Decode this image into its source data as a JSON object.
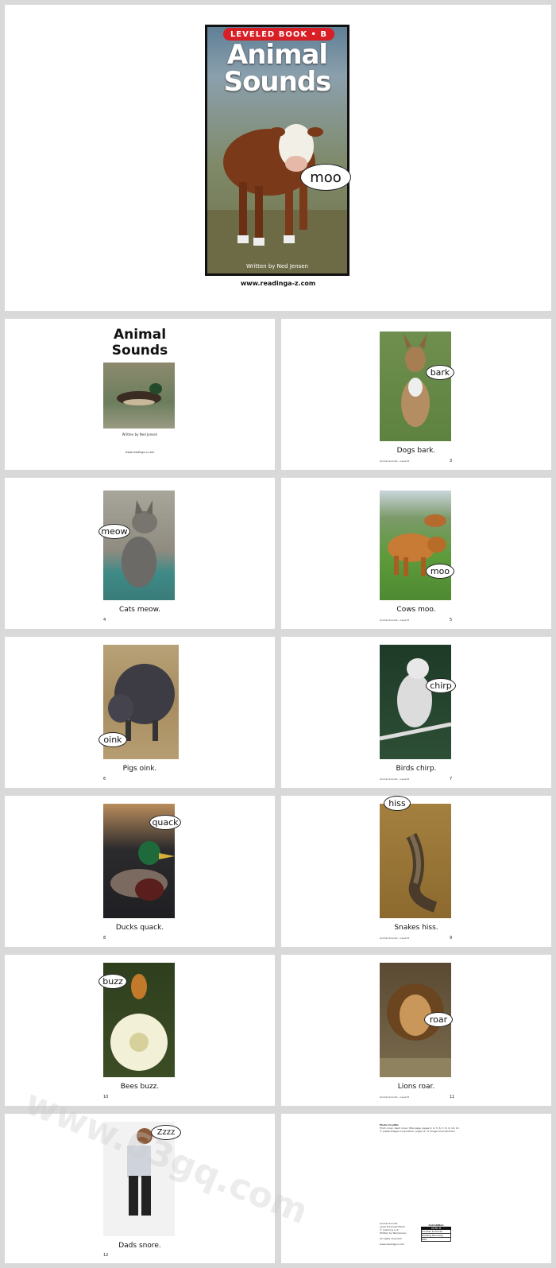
{
  "cover": {
    "banner": "LEVELED BOOK • B",
    "title_line1": "Animal",
    "title_line2": "Sounds",
    "bubble": "moo",
    "author": "Written by Ned Jensen",
    "url": "www.readinga-z.com"
  },
  "title_page": {
    "title_line1": "Animal",
    "title_line2": "Sounds",
    "author": "Written by Ned Jensen",
    "url": "www.readinga-z.com"
  },
  "pages": [
    {
      "caption": "Dogs  bark.",
      "bubble": "bark",
      "page": "3",
      "footer": "Animal Sounds • Level B"
    },
    {
      "caption": "Cats  meow.",
      "bubble": "meow",
      "page": "4"
    },
    {
      "caption": "Cows  moo.",
      "bubble": "moo",
      "page": "5",
      "footer": "Animal Sounds • Level B"
    },
    {
      "caption": "Pigs  oink.",
      "bubble": "oink",
      "page": "6"
    },
    {
      "caption": "Birds  chirp.",
      "bubble": "chirp",
      "page": "7",
      "footer": "Animal Sounds • Level B"
    },
    {
      "caption": "Ducks  quack.",
      "bubble": "quack",
      "page": "8"
    },
    {
      "caption": "Snakes  hiss.",
      "bubble": "hiss",
      "page": "9",
      "footer": "Animal Sounds • Level B"
    },
    {
      "caption": "Bees  buzz.",
      "bubble": "buzz",
      "page": "10"
    },
    {
      "caption": "Lions  roar.",
      "bubble": "roar",
      "page": "11",
      "footer": "Animal Sounds • Level B"
    },
    {
      "caption": "Dads  snore.",
      "bubble": "Zzzz",
      "page": "12"
    }
  ],
  "back_page": {
    "credits_title": "Photo Credits:",
    "credits_line1": "Front cover, back cover, title page, pages 3, 4, 5, 6, 7, 8, 9, 10, 11:",
    "credits_line2": "© JupiterImages Corporation; page 12: © Image Source/Corbis",
    "book_name": "Animal Sounds",
    "book_level": "Level B Leveled Book",
    "publisher": "© Learning A–Z",
    "writer": "Written by Ned Jensen",
    "rights": "All rights reserved.",
    "url": "www.readinga-z.com",
    "correlation_title": "Correlation",
    "correlation_header": "LEVEL B",
    "correlation_row1": "Fountas & Pinnell",
    "correlation_row2": "Reading Recovery",
    "correlation_row3": "DRA"
  },
  "watermark": "www.63gq.com"
}
